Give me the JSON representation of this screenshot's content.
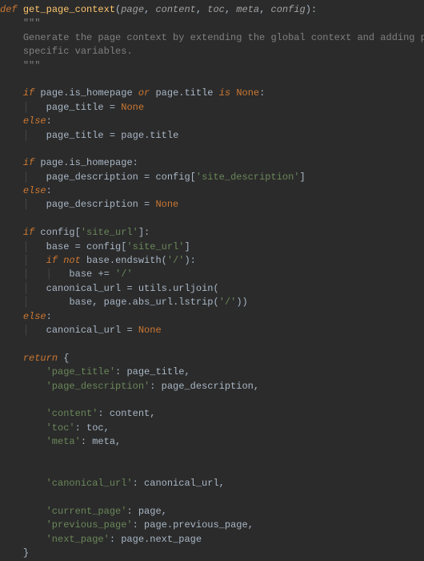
{
  "code": {
    "def": "def",
    "func_name": "get_page_context",
    "params": {
      "p1": "page",
      "p2": "content",
      "p3": "toc",
      "p4": "meta",
      "p5": "config"
    },
    "doc_open": "\"\"\"",
    "doc_line1": "Generate the page context by extending the global context and adding page",
    "doc_line2": "specific variables.",
    "doc_close": "\"\"\"",
    "kw_if": "if",
    "kw_or": "or",
    "kw_is": "is",
    "kw_else": "else",
    "kw_not": "not",
    "kw_return": "return",
    "none": "None",
    "ids": {
      "page": "page",
      "is_homepage": "is_homepage",
      "title": "title",
      "page_title": "page_title",
      "page_description": "page_description",
      "config": "config",
      "base": "base",
      "endswith": "endswith",
      "canonical_url": "canonical_url",
      "utils": "utils",
      "urljoin": "urljoin",
      "abs_url": "abs_url",
      "lstrip": "lstrip",
      "content": "content",
      "toc": "toc",
      "meta": "meta",
      "current_page": "current_page",
      "previous_page": "previous_page",
      "next_page": "next_page"
    },
    "strs": {
      "site_description": "'site_description'",
      "site_url": "'site_url'",
      "slash": "'/'",
      "k_page_title": "'page_title'",
      "k_page_description": "'page_description'",
      "k_content": "'content'",
      "k_toc": "'toc'",
      "k_meta": "'meta'",
      "k_canonical_url": "'canonical_url'",
      "k_current_page": "'current_page'",
      "k_previous_page": "'previous_page'",
      "k_next_page": "'next_page'"
    }
  }
}
